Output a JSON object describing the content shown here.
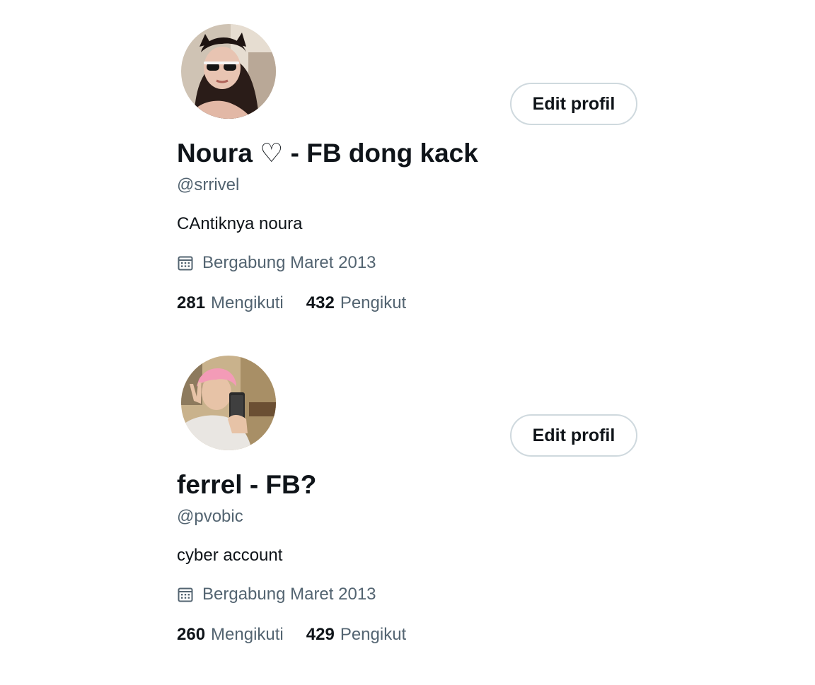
{
  "colors": {
    "text_primary": "#0f1419",
    "text_secondary": "#536471",
    "button_border": "#cfd9de",
    "background": "#ffffff"
  },
  "icons": {
    "joined": "calendar-icon"
  },
  "profiles": [
    {
      "edit_button": "Edit profil",
      "display_name": "Noura ♡ - FB dong kack",
      "handle": "@srrivel",
      "bio": "CAntiknya noura",
      "joined": "Bergabung Maret 2013",
      "following_count": "281",
      "following_label": "Mengikuti",
      "followers_count": "432",
      "followers_label": "Pengikut"
    },
    {
      "edit_button": "Edit profil",
      "display_name": "ferrel - FB?",
      "handle": "@pvobic",
      "bio": "cyber account",
      "joined": "Bergabung Maret 2013",
      "following_count": "260",
      "following_label": "Mengikuti",
      "followers_count": "429",
      "followers_label": "Pengikut"
    }
  ]
}
